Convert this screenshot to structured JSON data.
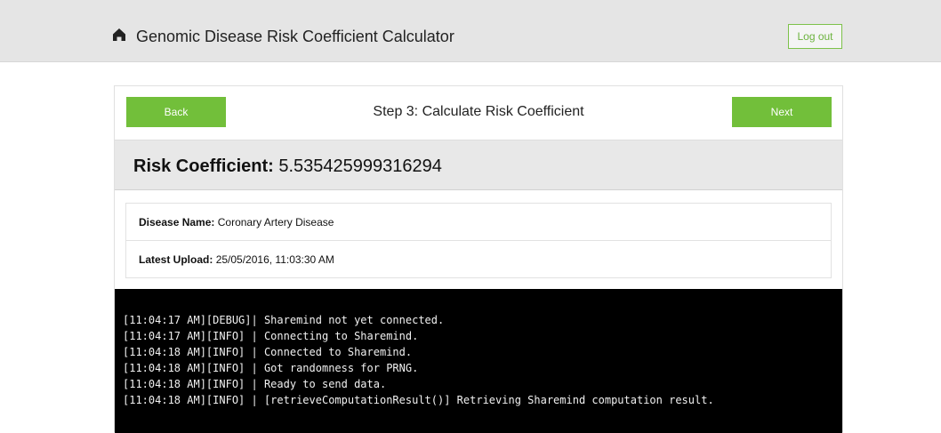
{
  "header": {
    "title": "Genomic Disease Risk Coefficient Calculator",
    "home_icon": "home-icon",
    "logout_label": "Log out"
  },
  "step": {
    "back_label": "Back",
    "next_label": "Next",
    "title": "Step 3: Calculate Risk Coefficient"
  },
  "risk": {
    "label": "Risk Coefficient:",
    "value": "5.535425999316294"
  },
  "info": {
    "disease_label": "Disease Name:",
    "disease_value": "Coronary Artery Disease",
    "upload_label": "Latest Upload:",
    "upload_value": "25/05/2016, 11:03:30 AM"
  },
  "console": {
    "lines": [
      "[11:04:17 AM][DEBUG]| Sharemind not yet connected.",
      "[11:04:17 AM][INFO] | Connecting to Sharemind.",
      "[11:04:18 AM][INFO] | Connected to Sharemind.",
      "[11:04:18 AM][INFO] | Got randomness for PRNG.",
      "[11:04:18 AM][INFO] | Ready to send data.",
      "[11:04:18 AM][INFO] | [retrieveComputationResult()] Retrieving Sharemind computation result."
    ]
  },
  "colors": {
    "accent": "#72bf3a",
    "navbar": "#e5e5e5",
    "console_bg": "#000000"
  }
}
